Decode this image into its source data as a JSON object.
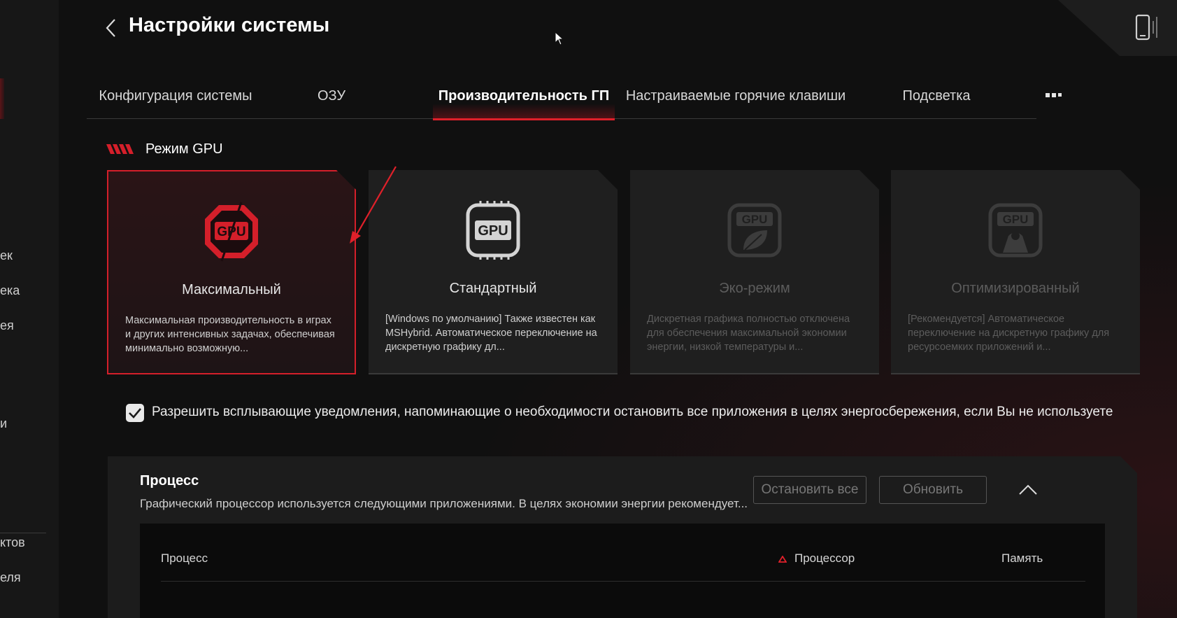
{
  "sidebar": {
    "items": [
      {
        "label": "ек",
        "top": 0
      },
      {
        "label": "ека"
      },
      {
        "label": "ея"
      },
      {
        "label": "и"
      },
      {
        "label": "ктов"
      },
      {
        "label": "еля"
      }
    ]
  },
  "header": {
    "title": "Настройки системы"
  },
  "tabs": [
    {
      "label": "Конфигурация системы"
    },
    {
      "label": "ОЗУ"
    },
    {
      "label": "Производительность ГП"
    },
    {
      "label": "Настраиваемые горячие клавиши"
    },
    {
      "label": "Подсветка"
    }
  ],
  "gpu_mode": {
    "title": "Режим GPU",
    "icon_text": "GPU",
    "cards": [
      {
        "title": "Максимальный",
        "desc": "Максимальная производительность в играх и других интенсивных задачах, обеспечивая минимально возможную...",
        "state": "selected"
      },
      {
        "title": "Стандартный",
        "desc": "[Windows по умолчанию] Также известен как MSHybrid. Автоматическое переключение на дискретную графику дл...",
        "state": "enabled"
      },
      {
        "title": "Эко-режим",
        "desc": "Дискретная графика полностью отключена для обеспечения максимальной экономии энергии, низкой температуры и...",
        "state": "disabled"
      },
      {
        "title": "Оптимизированный",
        "desc": "[Рекомендуется] Автоматическое переключение на дискретную графику для ресурсоемких приложений и...",
        "state": "disabled"
      }
    ]
  },
  "notification": {
    "checked": true,
    "label": "Разрешить всплывающие уведомления, напоминающие о необходимости остановить все приложения в целях энергосбережения, если Вы не используете"
  },
  "process_panel": {
    "title": "Процесс",
    "desc": "Графический процессор используется следующими приложениями. В целях экономии энергии рекомендует...",
    "stop_all_label": "Остановить все",
    "refresh_label": "Обновить",
    "columns": {
      "process": "Процесс",
      "cpu": "Процессор",
      "memory": "Память"
    }
  },
  "colors": {
    "accent": "#e0202a",
    "background": "#101010",
    "card": "#1f1f1f"
  }
}
